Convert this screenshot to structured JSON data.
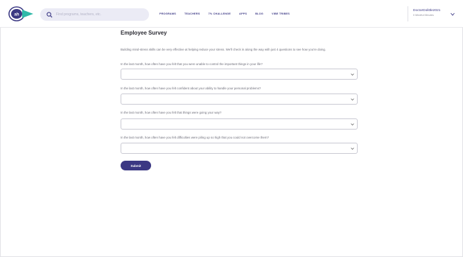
{
  "header": {
    "logo_text": "ah",
    "search": {
      "placeholder": "Find programs, teachers, etc.",
      "value": ""
    },
    "nav": [
      "PROGRAMS",
      "TEACHERS",
      "7% CHALLENGE",
      "APPS",
      "BLOG",
      "VIBE TRIBES"
    ],
    "user": {
      "name": "DoctorDolittle2021",
      "subtitle": "0 Mindful Minutes"
    }
  },
  "survey": {
    "title": "Employee Survey",
    "intro": "Building mind-stress skills can be very effective at helping reduce your stress. We'll check in along the way with just 4 questions to see how you're doing.",
    "questions": [
      {
        "label": "In the last month, how often have you felt that you were unable to control the important things in your life?",
        "value": ""
      },
      {
        "label": "In the last month, how often have you felt confident about your ability to handle your personal problems?",
        "value": ""
      },
      {
        "label": "In the last month, how often have you felt that things were going your way?",
        "value": ""
      },
      {
        "label": "In the last month, how often have you felt difficulties were piling up so high that you could not overcome them?",
        "value": ""
      }
    ],
    "submit_label": "Submit"
  },
  "colors": {
    "brand": "#3b3883",
    "accent_teal": "#2fb9a8",
    "search_bg": "#ebebf5"
  },
  "icons": {
    "logo": "brand-logo",
    "search": "search-icon",
    "chevron": "chevron-down-icon"
  }
}
